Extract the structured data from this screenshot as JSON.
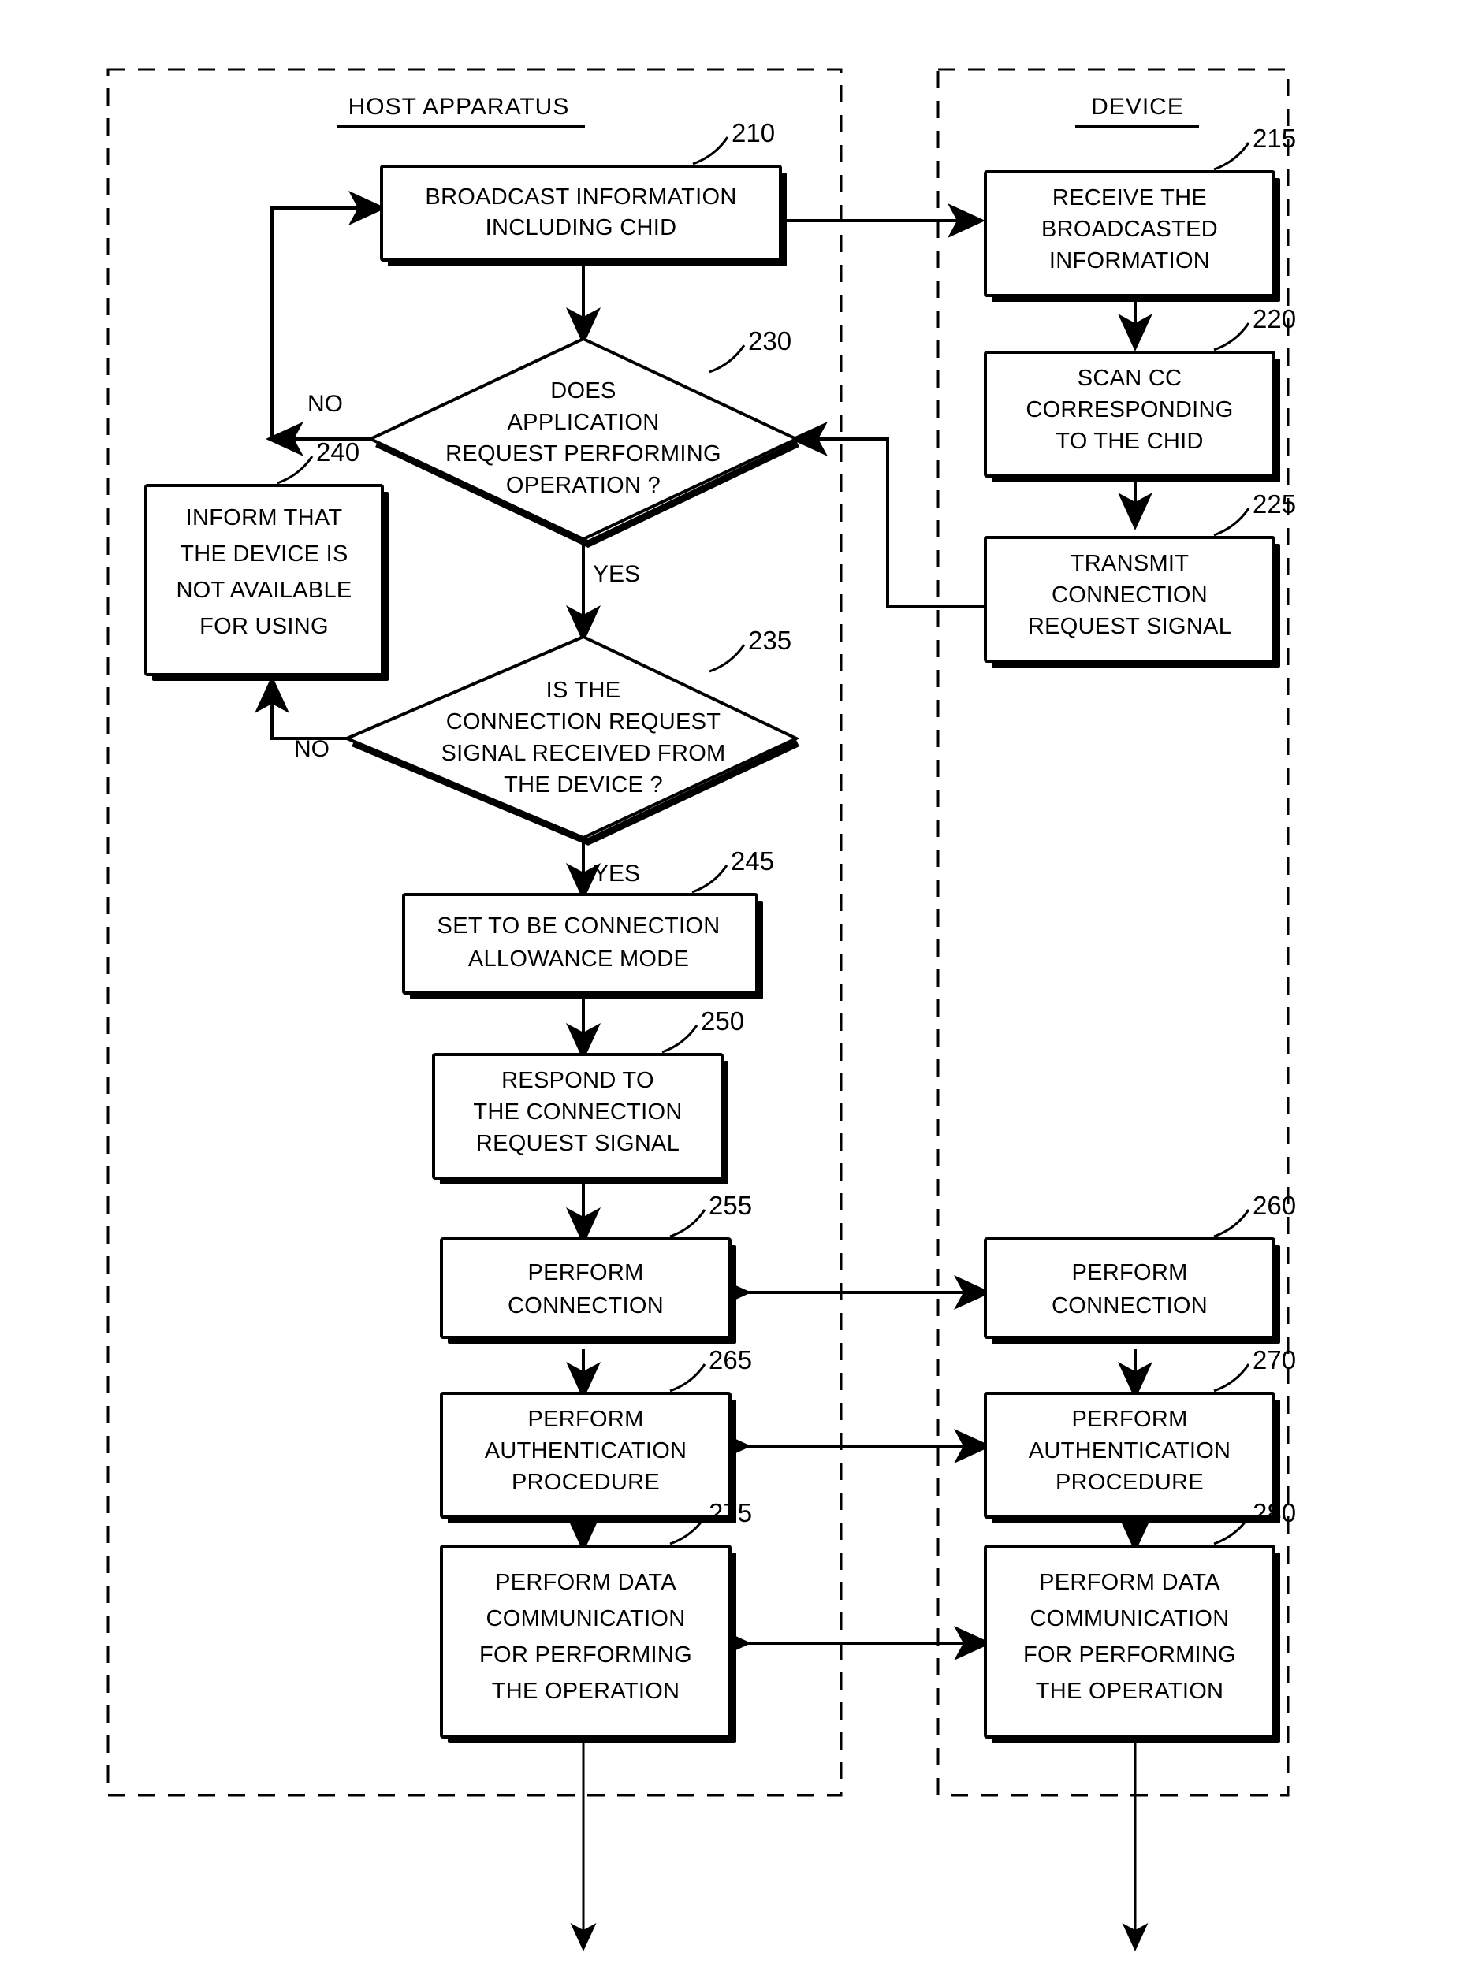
{
  "figure": {
    "type": "patent-flowchart",
    "lanes": [
      {
        "id": "host",
        "title": "HOST APPARATUS"
      },
      {
        "id": "device",
        "title": "DEVICE"
      }
    ],
    "branch_labels": {
      "no_230": "NO",
      "yes_230": "YES",
      "no_235": "NO",
      "yes_235": "YES"
    },
    "nodes": [
      {
        "id": "n210",
        "ref": "210",
        "lane": "host",
        "shape": "process",
        "lines": [
          "BROADCAST INFORMATION",
          "INCLUDING CHID"
        ]
      },
      {
        "id": "n215",
        "ref": "215",
        "lane": "device",
        "shape": "process",
        "lines": [
          "RECEIVE THE",
          "BROADCASTED",
          "INFORMATION"
        ]
      },
      {
        "id": "n220",
        "ref": "220",
        "lane": "device",
        "shape": "process",
        "lines": [
          "SCAN CC",
          "CORRESPONDING",
          "TO THE CHID"
        ]
      },
      {
        "id": "n225",
        "ref": "225",
        "lane": "device",
        "shape": "process",
        "lines": [
          "TRANSMIT",
          "CONNECTION",
          "REQUEST SIGNAL"
        ]
      },
      {
        "id": "n230",
        "ref": "230",
        "lane": "host",
        "shape": "decision",
        "lines": [
          "DOES",
          "APPLICATION",
          "REQUEST PERFORMING",
          "OPERATION ?"
        ]
      },
      {
        "id": "n235",
        "ref": "235",
        "lane": "host",
        "shape": "decision",
        "lines": [
          "IS THE",
          "CONNECTION REQUEST",
          "SIGNAL RECEIVED FROM",
          "THE DEVICE ?"
        ]
      },
      {
        "id": "n240",
        "ref": "240",
        "lane": "host",
        "shape": "process",
        "lines": [
          "INFORM THAT",
          "THE DEVICE IS",
          "NOT AVAILABLE",
          "FOR USING"
        ]
      },
      {
        "id": "n245",
        "ref": "245",
        "lane": "host",
        "shape": "process",
        "lines": [
          "SET TO BE CONNECTION",
          "ALLOWANCE MODE"
        ]
      },
      {
        "id": "n250",
        "ref": "250",
        "lane": "host",
        "shape": "process",
        "lines": [
          "RESPOND TO",
          "THE CONNECTION",
          "REQUEST SIGNAL"
        ]
      },
      {
        "id": "n255",
        "ref": "255",
        "lane": "host",
        "shape": "process",
        "lines": [
          "PERFORM",
          "CONNECTION"
        ]
      },
      {
        "id": "n260",
        "ref": "260",
        "lane": "device",
        "shape": "process",
        "lines": [
          "PERFORM",
          "CONNECTION"
        ]
      },
      {
        "id": "n265",
        "ref": "265",
        "lane": "host",
        "shape": "process",
        "lines": [
          "PERFORM",
          "AUTHENTICATION",
          "PROCEDURE"
        ]
      },
      {
        "id": "n270",
        "ref": "270",
        "lane": "device",
        "shape": "process",
        "lines": [
          "PERFORM",
          "AUTHENTICATION",
          "PROCEDURE"
        ]
      },
      {
        "id": "n275",
        "ref": "275",
        "lane": "host",
        "shape": "process",
        "lines": [
          "PERFORM DATA",
          "COMMUNICATION",
          "FOR PERFORMING",
          "THE OPERATION"
        ]
      },
      {
        "id": "n280",
        "ref": "280",
        "lane": "device",
        "shape": "process",
        "lines": [
          "PERFORM DATA",
          "COMMUNICATION",
          "FOR PERFORMING",
          "THE OPERATION"
        ]
      }
    ],
    "colors": {
      "stroke": "#000000",
      "fill": "#ffffff",
      "background": "#ffffff"
    }
  }
}
